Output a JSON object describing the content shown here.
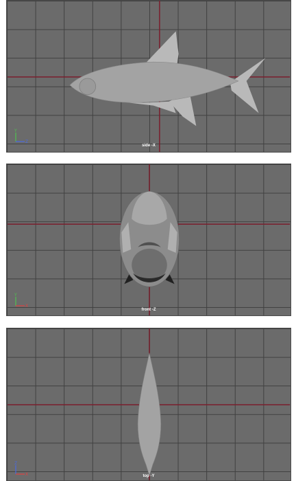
{
  "viewports": {
    "side": {
      "label": "side -X",
      "axes": {
        "up": "Y",
        "right": "Z"
      }
    },
    "front": {
      "label": "front -Z",
      "axes": {
        "up": "Y",
        "right": "X"
      }
    },
    "top": {
      "label": "top -Y",
      "axes": {
        "up": "Z",
        "right": "X"
      }
    }
  },
  "colors": {
    "viewport_bg": "#6b6b6b",
    "grid_line": "#404040",
    "origin_axis": "#7a1e2c",
    "model_fill": "#a3a3a3",
    "fin_fill": "#b9b9b9",
    "axis_x": "#e04040",
    "axis_y": "#4fc24f",
    "axis_z": "#4a6ae0",
    "label_text": "#ffffff"
  }
}
